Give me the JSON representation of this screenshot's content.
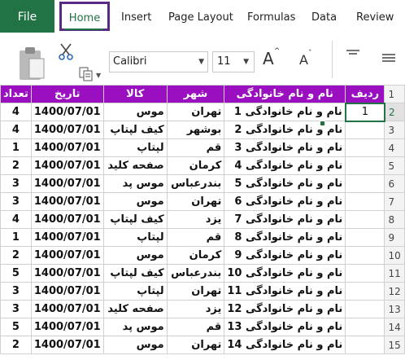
{
  "ribbon_tabs": [
    "File",
    "Home",
    "Insert",
    "Page Layout",
    "Formulas",
    "Data",
    "Review"
  ],
  "ribbon": {
    "font_name": "Calibri",
    "font_size": "11",
    "grow_font_label": "A",
    "shrink_font_label": "A"
  },
  "icons": [
    "paste-icon",
    "cut-icon",
    "copy-icon",
    "grow-font-icon",
    "shrink-font-icon",
    "align-top-icon",
    "align-middle-icon"
  ],
  "colors": {
    "file_tab": "#217346",
    "header_fill": "#9a0fbf",
    "home_highlight": "#5b2a86",
    "selection": "#217346"
  },
  "sheet": {
    "headers": [
      "تعداد",
      "تاریخ",
      "کالا",
      "شهر",
      "نام و نام خانوادگی",
      "ردیف"
    ],
    "row_numbers": [
      "1",
      "2",
      "3",
      "4",
      "5",
      "6",
      "7",
      "8",
      "9",
      "10",
      "11",
      "12",
      "13",
      "14",
      "15"
    ],
    "selected_value": "1",
    "rows": [
      [
        "4",
        "1400/07/01",
        "موس",
        "تهران",
        "نام و نام خانوادگی 1"
      ],
      [
        "4",
        "1400/07/01",
        "کیف لپتاپ",
        "بوشهر",
        "نام و نام خانوادگی 2"
      ],
      [
        "1",
        "1400/07/01",
        "لپتاپ",
        "قم",
        "نام و نام خانوادگی 3"
      ],
      [
        "2",
        "1400/07/01",
        "صفحه کلید",
        "کرمان",
        "نام و نام خانوادگی 4"
      ],
      [
        "3",
        "1400/07/01",
        "موس پد",
        "بندرعباس",
        "نام و نام خانوادگی 5"
      ],
      [
        "3",
        "1400/07/01",
        "موس",
        "تهران",
        "نام و نام خانوادگی 6"
      ],
      [
        "4",
        "1400/07/01",
        "کیف لپتاپ",
        "یزد",
        "نام و نام خانوادگی 7"
      ],
      [
        "1",
        "1400/07/01",
        "لپتاپ",
        "قم",
        "نام و نام خانوادگی 8"
      ],
      [
        "2",
        "1400/07/01",
        "موس",
        "کرمان",
        "نام و نام خانوادگی 9"
      ],
      [
        "5",
        "1400/07/01",
        "کیف لپتاپ",
        "بندرعباس",
        "نام و نام خانوادگی 10"
      ],
      [
        "3",
        "1400/07/01",
        "لپتاپ",
        "تهران",
        "نام و نام خانوادگی 11"
      ],
      [
        "3",
        "1400/07/01",
        "صفحه کلید",
        "یزد",
        "نام و نام خانوادگی 12"
      ],
      [
        "5",
        "1400/07/01",
        "موس پد",
        "قم",
        "نام و نام خانوادگی 13"
      ],
      [
        "2",
        "1400/07/01",
        "موس",
        "تهران",
        "نام و نام خانوادگی 14"
      ]
    ]
  }
}
